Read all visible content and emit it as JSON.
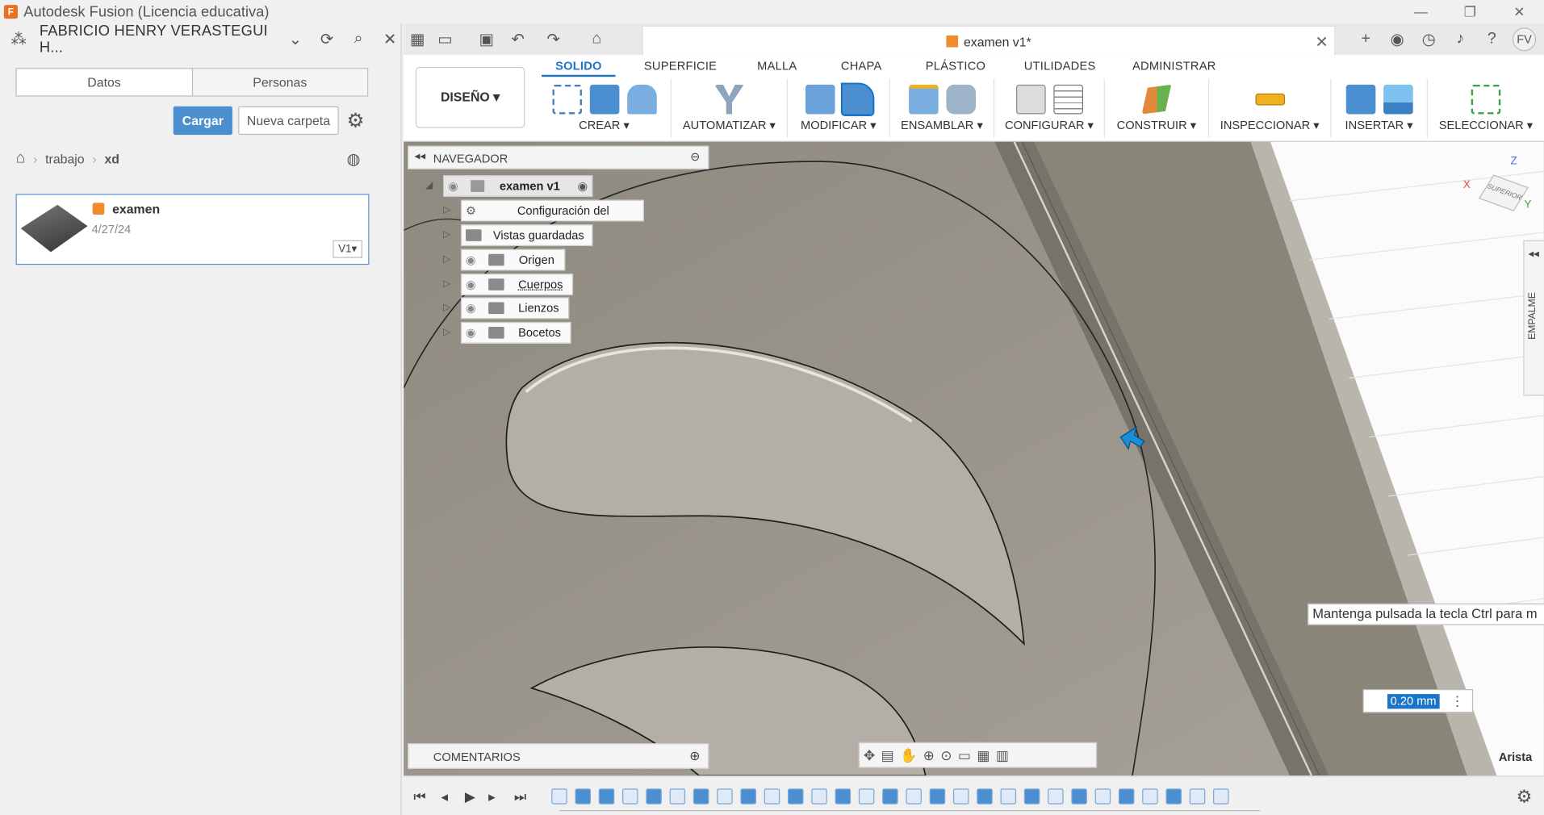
{
  "window": {
    "title": "Autodesk Fusion (Licencia educativa)",
    "controls": [
      "—",
      "❐",
      "✕"
    ]
  },
  "leftpanel": {
    "team": "FABRICIO HENRY VERASTEGUI H...",
    "tabs": [
      "Datos",
      "Personas"
    ],
    "upload": "Cargar",
    "new_folder": "Nueva carpeta",
    "breadcrumb": [
      "trabajo",
      "xd"
    ],
    "file": {
      "name": "examen",
      "date": "4/27/24",
      "version": "V1"
    }
  },
  "document": {
    "title": "examen v1*"
  },
  "user": {
    "initials": "FV"
  },
  "ribbon": {
    "workspace": "DISEÑO",
    "tabs": [
      "SOLIDO",
      "SUPERFICIE",
      "MALLA",
      "CHAPA",
      "PLÁSTICO",
      "UTILIDADES",
      "ADMINISTRAR"
    ],
    "groups": [
      "CREAR",
      "AUTOMATIZAR",
      "MODIFICAR",
      "ENSAMBLAR",
      "CONFIGURAR",
      "CONSTRUIR",
      "INSPECCIONAR",
      "INSERTAR",
      "SELECCIONAR"
    ]
  },
  "browser": {
    "title": "NAVEGADOR",
    "root": "examen v1",
    "items": [
      "Configuración del documento",
      "Vistas guardadas",
      "Origen",
      "Cuerpos",
      "Lienzos",
      "Bocetos"
    ]
  },
  "comments": {
    "title": "COMENTARIOS"
  },
  "tooltip": "Mantenga pulsada la tecla Ctrl para m",
  "dimension": {
    "value": "0.20 mm"
  },
  "status": {
    "selection": "Arista"
  },
  "sidepanel": {
    "label": "EMPALME"
  },
  "viewcube": {
    "face": "SUPERIOR",
    "axes": [
      "Z",
      "X",
      "Y"
    ]
  },
  "colors": {
    "accent": "#1a74c9",
    "upload_button": "#4b8fd1",
    "model": "#9c978e"
  }
}
